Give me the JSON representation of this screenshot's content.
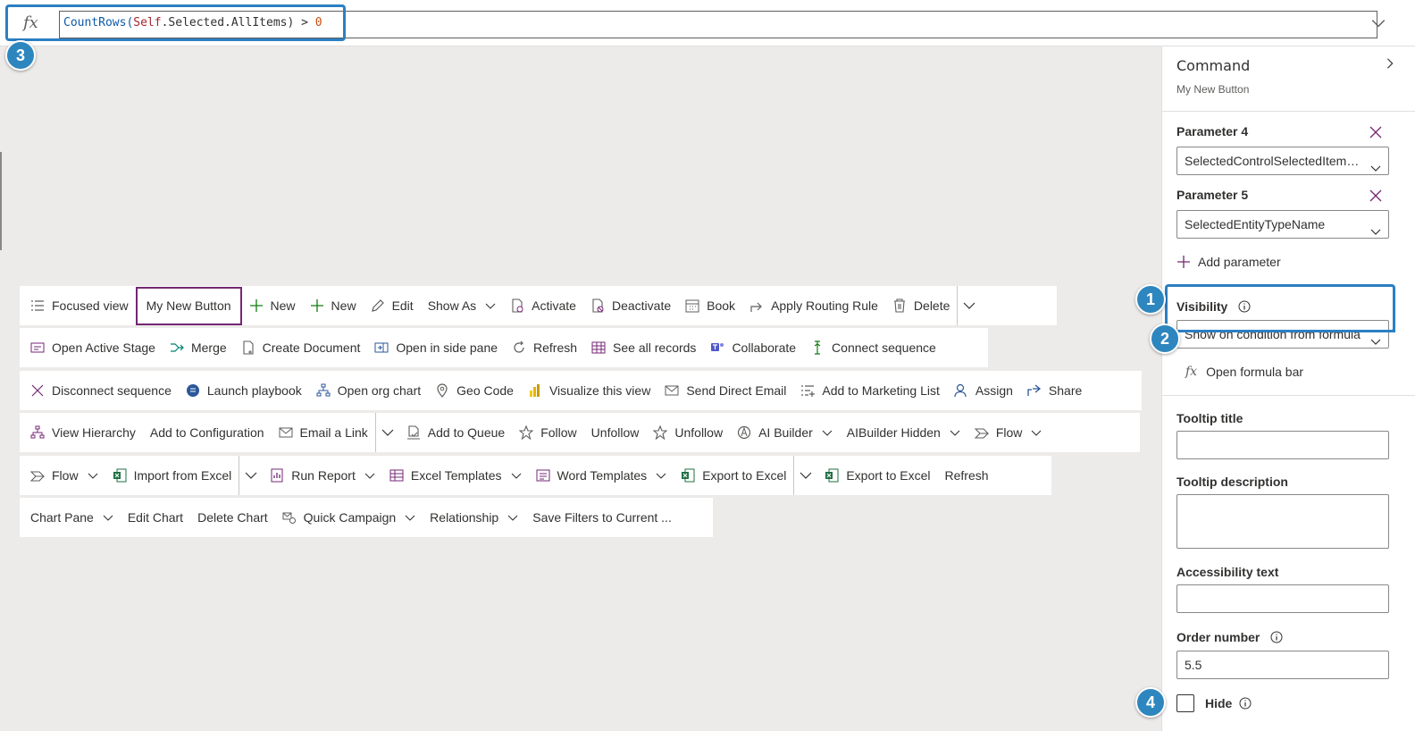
{
  "formula_bar": {
    "fx": "fx",
    "formula_parts": [
      "CountRows(",
      "Self",
      ".Selected.AllItems) > ",
      "0"
    ]
  },
  "badges": [
    "1",
    "2",
    "3",
    "4"
  ],
  "command_rows": [
    [
      {
        "label": "Focused view",
        "icon": "list-icon"
      },
      {
        "label": "My New Button",
        "icon": "",
        "selected": true
      },
      {
        "label": "New",
        "icon": "plus-icon"
      },
      {
        "label": "New",
        "icon": "plus-icon"
      },
      {
        "label": "Edit",
        "icon": "pencil-icon"
      },
      {
        "label": "Show As",
        "icon": "",
        "chevron": true
      },
      {
        "label": "Activate",
        "icon": "activate-icon"
      },
      {
        "label": "Deactivate",
        "icon": "deactivate-icon"
      },
      {
        "label": "Book",
        "icon": "calendar-icon"
      },
      {
        "label": "Apply Routing Rule",
        "icon": "route-icon"
      },
      {
        "label": "Delete",
        "icon": "trash-icon"
      },
      {
        "split": true
      }
    ],
    [
      {
        "label": "Open Active Stage",
        "icon": "stage-icon"
      },
      {
        "label": "Merge",
        "icon": "merge-icon"
      },
      {
        "label": "Create Document",
        "icon": "document-icon"
      },
      {
        "label": "Open in side pane",
        "icon": "side-pane-icon"
      },
      {
        "label": "Refresh",
        "icon": "refresh-icon"
      },
      {
        "label": "See all records",
        "icon": "grid-icon"
      },
      {
        "label": "Collaborate",
        "icon": "teams-icon"
      },
      {
        "label": "Connect sequence",
        "icon": "sequence-icon"
      }
    ],
    [
      {
        "label": "Disconnect sequence",
        "icon": "close-icon"
      },
      {
        "label": "Launch playbook",
        "icon": "playbook-icon"
      },
      {
        "label": "Open org chart",
        "icon": "org-chart-icon"
      },
      {
        "label": "Geo Code",
        "icon": "location-icon"
      },
      {
        "label": "Visualize this view",
        "icon": "powerbi-icon"
      },
      {
        "label": "Send Direct Email",
        "icon": "email-icon"
      },
      {
        "label": "Add to Marketing List",
        "icon": "add-list-icon"
      },
      {
        "label": "Assign",
        "icon": "person-icon"
      },
      {
        "label": "Share",
        "icon": "share-icon"
      }
    ],
    [
      {
        "label": "View Hierarchy",
        "icon": "hierarchy-icon"
      },
      {
        "label": "Add to Configuration",
        "icon": ""
      },
      {
        "label": "Email a Link",
        "icon": "email-link-icon"
      },
      {
        "split": true
      },
      {
        "label": "Add to Queue",
        "icon": "queue-icon"
      },
      {
        "label": "Follow",
        "icon": "star-icon"
      },
      {
        "label": "Unfollow",
        "icon": ""
      },
      {
        "label": "Unfollow",
        "icon": "star-icon"
      },
      {
        "label": "AI Builder",
        "icon": "ai-builder-icon",
        "chevron": true
      },
      {
        "label": "AIBuilder Hidden",
        "icon": "",
        "chevron": true
      },
      {
        "label": "Flow",
        "icon": "flow-icon",
        "chevron": true
      }
    ],
    [
      {
        "label": "Flow",
        "icon": "flow-icon",
        "chevron": true
      },
      {
        "label": "Import from Excel",
        "icon": "excel-icon"
      },
      {
        "split": true
      },
      {
        "label": "Run Report",
        "icon": "report-icon",
        "chevron": true
      },
      {
        "label": "Excel Templates",
        "icon": "excel-template-icon",
        "chevron": true
      },
      {
        "label": "Word Templates",
        "icon": "word-template-icon",
        "chevron": true
      },
      {
        "label": "Export to Excel",
        "icon": "excel-icon"
      },
      {
        "split": true
      },
      {
        "label": "Export to Excel",
        "icon": "excel-icon"
      },
      {
        "label": "Refresh",
        "icon": ""
      }
    ],
    [
      {
        "label": "Chart Pane",
        "icon": "",
        "chevron": true
      },
      {
        "label": "Edit Chart",
        "icon": ""
      },
      {
        "label": "Delete Chart",
        "icon": ""
      },
      {
        "label": "Quick Campaign",
        "icon": "campaign-icon",
        "chevron": true
      },
      {
        "label": "Relationship",
        "icon": "",
        "chevron": true
      },
      {
        "label": "Save Filters to Current ...",
        "icon": ""
      }
    ]
  ],
  "panel": {
    "title": "Command",
    "subtitle": "My New Button",
    "param4_label": "Parameter 4",
    "param4_value": "SelectedControlSelectedItemC...",
    "param5_label": "Parameter 5",
    "param5_value": "SelectedEntityTypeName",
    "add_parameter": "Add parameter",
    "visibility_label": "Visibility",
    "visibility_value": "Show on condition from formula",
    "open_formula_fx": "fx",
    "open_formula": "Open formula bar",
    "tooltip_title_label": "Tooltip title",
    "tooltip_title_value": "",
    "tooltip_desc_label": "Tooltip description",
    "tooltip_desc_value": "",
    "accessibility_label": "Accessibility text",
    "accessibility_value": "",
    "order_label": "Order number",
    "order_value": "5.5",
    "hide_label": "Hide",
    "hide_checked": false
  },
  "colors": {
    "accent": "#2e86bf",
    "selected_border": "#742774",
    "background": "#edebe9"
  }
}
